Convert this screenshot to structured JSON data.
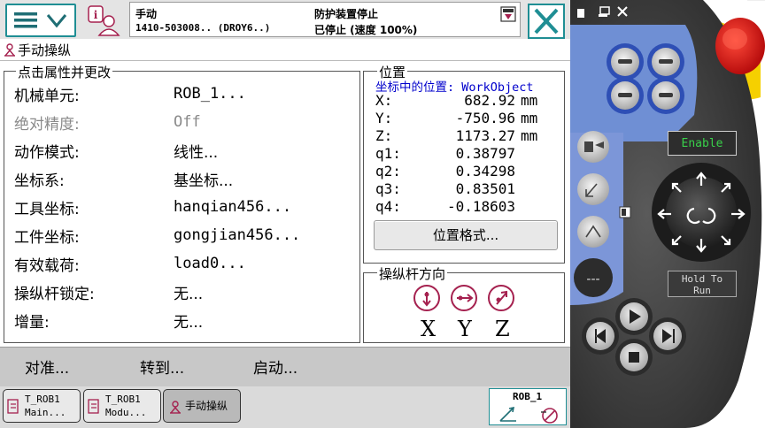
{
  "header": {
    "mode": "手动",
    "system_name": "1410-503008.. (DROY6..)",
    "safety_state": "防护装置停止",
    "run_state": "已停止 (速度 100%)"
  },
  "page": {
    "title": "手动操纵"
  },
  "properties": {
    "legend": "点击属性并更改",
    "rows": [
      {
        "label": "机械单元:",
        "value": "ROB_1..."
      },
      {
        "label": "绝对精度:",
        "value": "Off"
      },
      {
        "label": "动作模式:",
        "value": "线性..."
      },
      {
        "label": "坐标系:",
        "value": "基坐标..."
      },
      {
        "label": "工具坐标:",
        "value": "hanqian456..."
      },
      {
        "label": "工件坐标:",
        "value": "gongjian456..."
      },
      {
        "label": "有效载荷:",
        "value": "load0..."
      },
      {
        "label": "操纵杆锁定:",
        "value": "无..."
      },
      {
        "label": "增量:",
        "value": "无..."
      }
    ]
  },
  "position": {
    "legend": "位置",
    "subtitle": "坐标中的位置: WorkObject",
    "rows": [
      {
        "label": "X:",
        "value": "682.92",
        "unit": "mm"
      },
      {
        "label": "Y:",
        "value": "-750.96",
        "unit": "mm"
      },
      {
        "label": "Z:",
        "value": "1173.27",
        "unit": "mm"
      },
      {
        "label": "q1:",
        "value": "0.38797",
        "unit": ""
      },
      {
        "label": "q2:",
        "value": "0.34298",
        "unit": ""
      },
      {
        "label": "q3:",
        "value": "0.83501",
        "unit": ""
      },
      {
        "label": "q4:",
        "value": "-0.18603",
        "unit": ""
      }
    ],
    "format_button": "位置格式..."
  },
  "joystick": {
    "legend": "操纵杆方向",
    "axes": [
      "X",
      "Y",
      "Z"
    ]
  },
  "actions": {
    "align": "对准...",
    "goto": "转到...",
    "start": "启动..."
  },
  "taskbar": {
    "items": [
      {
        "line1": "T_ROB1",
        "line2": "Main..."
      },
      {
        "line1": "T_ROB1",
        "line2": "Modu..."
      },
      {
        "line1": "手动操纵",
        "line2": ""
      }
    ],
    "robot_label": "ROB_1"
  },
  "flexpendant": {
    "enable_label": "Enable",
    "hold_label_1": "Hold To",
    "hold_label_2": "Run"
  },
  "colors": {
    "accent": "#1f8e94",
    "joystick_icon": "#a5214f",
    "position_subtitle": "#0000cc",
    "enable_text": "#39d04a"
  }
}
